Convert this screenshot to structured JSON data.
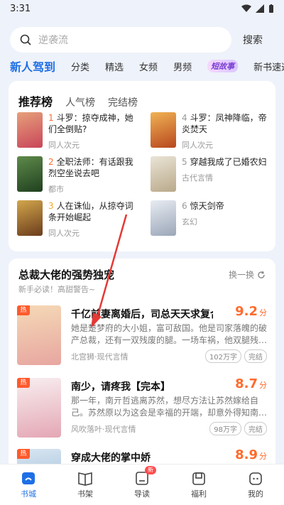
{
  "status": {
    "time": "3:31"
  },
  "search": {
    "placeholder": "逆袭流",
    "button": "搜索"
  },
  "tabs": [
    "新人驾到",
    "分类",
    "精选",
    "女频",
    "男频",
    "短故事",
    "新书速递"
  ],
  "rank": {
    "title": "推荐榜",
    "tabs": [
      "人气榜",
      "完结榜"
    ],
    "items": [
      {
        "num": "1",
        "line1": "斗罗：掠夺成神，她",
        "line2": "们全倒贴?",
        "tag": "同人次元"
      },
      {
        "num": "2",
        "line1": "全职法师：有话跟我",
        "line2": "烈空坐说去吧",
        "tag": "都市"
      },
      {
        "num": "3",
        "line1": "人在诛仙，从掠夺词",
        "line2": "条开始崛起",
        "tag": "同人次元"
      },
      {
        "num": "4",
        "line1": "斗罗：凤神降临，帝",
        "line2": "炎焚天",
        "tag": "同人次元"
      },
      {
        "num": "5",
        "line1": "穿越我成了已婚农妇",
        "line2": "",
        "tag": "古代言情"
      },
      {
        "num": "6",
        "line1": "惊天剑帝",
        "line2": "",
        "tag": "玄幻"
      }
    ]
  },
  "recommend": {
    "title": "总裁大佬的强势独宠",
    "refresh": "换一换",
    "subtitle": "新手必读！高甜警告~",
    "books": [
      {
        "badge": "热",
        "title": "千亿前妻离婚后，司总天天求复合",
        "score": "9.2",
        "unit": "分",
        "desc": "她是楚梦府的大小姐，富可敌国。他是司家落魄的破产总裁，还有一双残废的腿。一场车祸，他双腿残…",
        "meta": "北宫狮·现代言情",
        "words": "102万字",
        "status": "完结"
      },
      {
        "badge": "热",
        "title": "南少，请疼我【完本】",
        "score": "8.7",
        "unit": "分",
        "desc": "那一年，南亓哲逃离苏然，想尽方法让苏然嫁给自己。苏然原以为这会是幸福的开端，却意外得知南…",
        "meta": "风吹落叶·现代言情",
        "words": "98万字",
        "status": "完结"
      },
      {
        "badge": "热",
        "title": "穿成大佬的掌中娇",
        "score": "8.9",
        "unit": "分",
        "desc": "",
        "meta": "",
        "words": "",
        "status": ""
      }
    ]
  },
  "nav": [
    {
      "label": "书城",
      "icon": "home-icon"
    },
    {
      "label": "书架",
      "icon": "bookshelf-icon"
    },
    {
      "label": "导读",
      "icon": "guide-icon",
      "badge": "新"
    },
    {
      "label": "福利",
      "icon": "gift-icon"
    },
    {
      "label": "我的",
      "icon": "profile-icon"
    }
  ],
  "colors": {
    "accent": "#1e6fe6",
    "score": "#ff6b2c",
    "arrow": "#e53935"
  }
}
